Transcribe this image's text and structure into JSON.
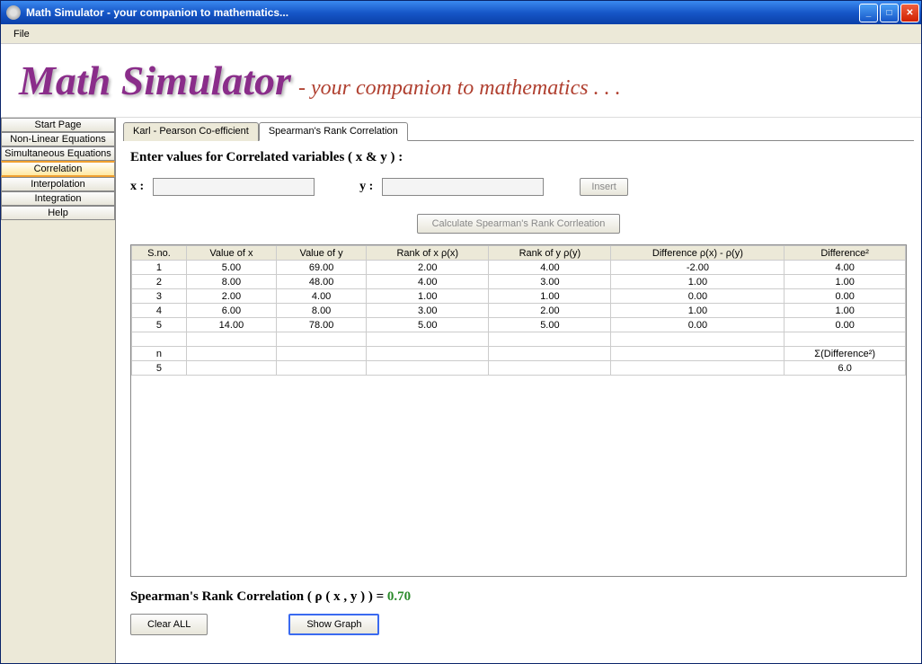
{
  "window": {
    "title": "Math Simulator - your companion to mathematics..."
  },
  "menubar": {
    "file": "File"
  },
  "banner": {
    "main": "Math Simulator",
    "sub": "- your companion to mathematics . . ."
  },
  "sidebar": {
    "items": [
      "Start Page",
      "Non-Linear Equations",
      "Simultaneous Equations",
      "Correlation",
      "Interpolation",
      "Integration",
      "Help"
    ],
    "selected_index": 3
  },
  "tabs": {
    "items": [
      "Karl - Pearson Co-efficient",
      "Spearman's Rank Correlation"
    ],
    "active_index": 1
  },
  "form": {
    "prompt": "Enter values for Correlated variables ( x & y ) :",
    "x_label": "x :",
    "y_label": "y :",
    "x_value": "",
    "y_value": "",
    "insert_label": "Insert",
    "calc_label": "Calculate Spearman's Rank Corrleation"
  },
  "table": {
    "headers": [
      "S.no.",
      "Value of x",
      "Value of y",
      "Rank of x  ρ(x)",
      "Rank of y  ρ(y)",
      "Difference  ρ(x) - ρ(y)",
      "Difference²"
    ],
    "rows": [
      [
        "1",
        "5.00",
        "69.00",
        "2.00",
        "4.00",
        "-2.00",
        "4.00"
      ],
      [
        "2",
        "8.00",
        "48.00",
        "4.00",
        "3.00",
        "1.00",
        "1.00"
      ],
      [
        "3",
        "2.00",
        "4.00",
        "1.00",
        "1.00",
        "0.00",
        "0.00"
      ],
      [
        "4",
        "6.00",
        "8.00",
        "3.00",
        "2.00",
        "1.00",
        "1.00"
      ],
      [
        "5",
        "14.00",
        "78.00",
        "5.00",
        "5.00",
        "0.00",
        "0.00"
      ]
    ],
    "summary_header": [
      "n",
      "",
      "",
      "",
      "",
      "",
      "Σ(Difference²)"
    ],
    "summary_values": [
      "5",
      "",
      "",
      "",
      "",
      "",
      "6.0"
    ]
  },
  "result": {
    "label": "Spearman's Rank Correlation ( ρ ( x , y ) )  =  ",
    "value": "0.70"
  },
  "actions": {
    "clear": "Clear ALL",
    "graph": "Show Graph"
  }
}
